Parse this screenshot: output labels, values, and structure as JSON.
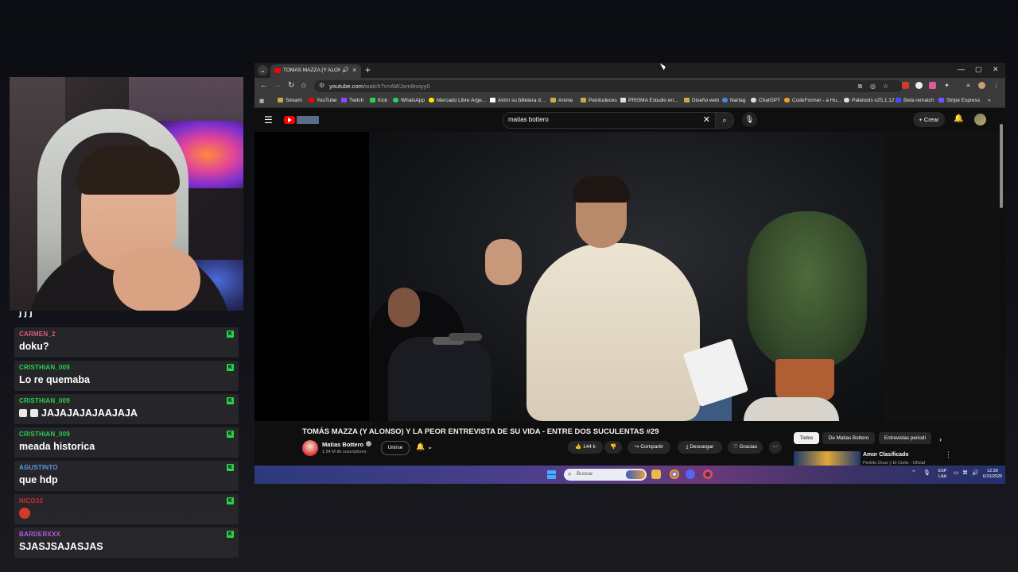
{
  "chat": {
    "top_fragment": "j j j",
    "messages": [
      {
        "user": "CARMEN_2",
        "user_color": "#e05a7a",
        "text": "doku?"
      },
      {
        "user": "CRISTHIAN_009",
        "user_color": "#2bd14a",
        "text": "Lo re quemaba"
      },
      {
        "user": "CRISTHIAN_009",
        "user_color": "#2bd14a",
        "text": "JAJAJAJAJAAJAJA"
      },
      {
        "user": "CRISTHIAN_009",
        "user_color": "#2bd14a",
        "text": "meada historica"
      },
      {
        "user": "AGUSTINTO",
        "user_color": "#5a9ae0",
        "text": "que hdp"
      },
      {
        "user": "NICO33",
        "user_color": "#d12b2b",
        "text": ""
      },
      {
        "user": "BARDERXXX",
        "user_color": "#b55ae0",
        "text": "SJASJSAJASJAS"
      }
    ],
    "badge_letter": "K"
  },
  "browser": {
    "tab": {
      "title": "TOMÁS MAZZA (Y ALONSO)"
    },
    "url_host": "youtube.com",
    "url_path": "/watch?v=AWJxm8noyy0",
    "bookmarks": [
      {
        "label": "Stream",
        "color": "#cfa64a"
      },
      {
        "label": "YouTube",
        "color": "#ff0000"
      },
      {
        "label": "Twitch",
        "color": "#9146ff"
      },
      {
        "label": "Kick",
        "color": "#2bd14a"
      },
      {
        "label": "WhatsApp",
        "color": "#25d366"
      },
      {
        "label": "Mercado Libre Arge...",
        "color": "#ffe600"
      },
      {
        "label": "Airtm su billetera d...",
        "color": "#ffffff"
      },
      {
        "label": "Anime",
        "color": "#cfa64a"
      },
      {
        "label": "Pelotudeces",
        "color": "#cfa64a"
      },
      {
        "label": "PRISMA Estudio en...",
        "color": "#dddddd"
      },
      {
        "label": "Diseño web",
        "color": "#cfa64a"
      },
      {
        "label": "Nartag",
        "color": "#4a8ae0"
      },
      {
        "label": "ChatGPT",
        "color": "#dddddd"
      },
      {
        "label": "CodeFormer - a Hu...",
        "color": "#f0a030"
      },
      {
        "label": "Paletools v25.1.12",
        "color": "#dddddd"
      },
      {
        "label": "Beta rematch",
        "color": "#4a4aff"
      },
      {
        "label": "Stripe Express",
        "color": "#635bff"
      }
    ]
  },
  "youtube": {
    "search_query": "matias bottero",
    "create_label": "Crear",
    "video_title": "TOMÁS MAZZA (Y ALONSO) Y LA PEOR ENTREVISTA DE SU VIDA - ENTRE DOS SUCULENTAS #29",
    "channel_name": "Matias Bottero",
    "subscribers": "1.54 M de suscriptores",
    "join_label": "Unirse",
    "likes": "144 k",
    "share_label": "Compartir",
    "download_label": "Descargar",
    "thanks_label": "Gracias",
    "chips": [
      "Todos",
      "De Matias Bottero",
      "Entrevistas periodí"
    ],
    "rec_title": "Amor Clasificado",
    "rec_sub": "Pedrito Duoz y El Cietic - Oficial"
  },
  "taskbar": {
    "search_placeholder": "Buscar",
    "lang_top": "ESP",
    "lang_bottom": "LAA",
    "time": "12:39",
    "date": "6/10/2025"
  }
}
